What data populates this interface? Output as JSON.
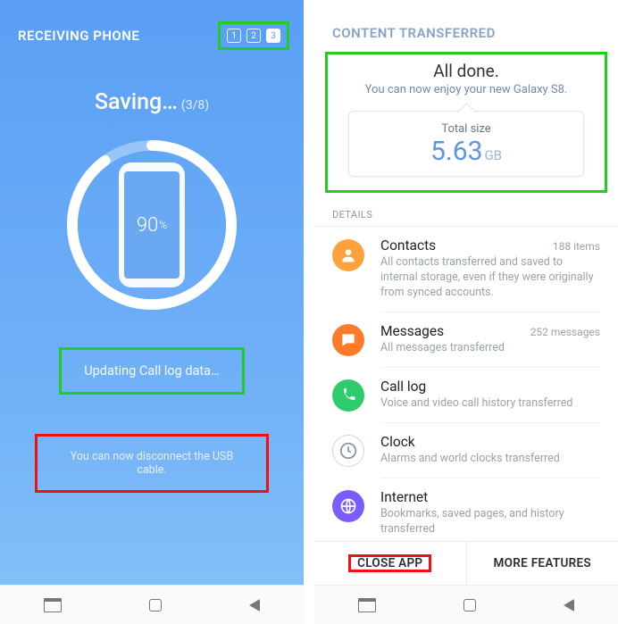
{
  "left": {
    "header_title": "RECEIVING PHONE",
    "steps": [
      "1",
      "2",
      "3"
    ],
    "active_step_index": 2,
    "saving_label": "Saving…",
    "saving_progress": "(3/8)",
    "percent_value": "90",
    "percent_sign": "%",
    "ring_percent": 90,
    "status_line": "Updating Call log data…",
    "disconnect_line": "You can now disconnect the USB cable."
  },
  "right": {
    "header_title": "CONTENT TRANSFERRED",
    "done_title": "All done.",
    "done_sub": "You can now enjoy your new Galaxy S8.",
    "size_label": "Total size",
    "size_value": "5.63",
    "size_unit": "GB",
    "details_header": "DETAILS",
    "items": [
      {
        "icon": "contacts",
        "title": "Contacts",
        "count": "188 items",
        "desc": "All contacts transferred and saved to internal storage, even if they were originally from synced accounts."
      },
      {
        "icon": "messages",
        "title": "Messages",
        "count": "252 messages",
        "desc": "All messages transferred"
      },
      {
        "icon": "calllog",
        "title": "Call log",
        "count": "",
        "desc": "Voice and video call history transferred"
      },
      {
        "icon": "clock",
        "title": "Clock",
        "count": "",
        "desc": "Alarms and world clocks transferred"
      },
      {
        "icon": "internet",
        "title": "Internet",
        "count": "",
        "desc": "Bookmarks, saved pages, and history transferred"
      }
    ],
    "actions": {
      "close": "CLOSE APP",
      "more": "MORE FEATURES"
    }
  }
}
